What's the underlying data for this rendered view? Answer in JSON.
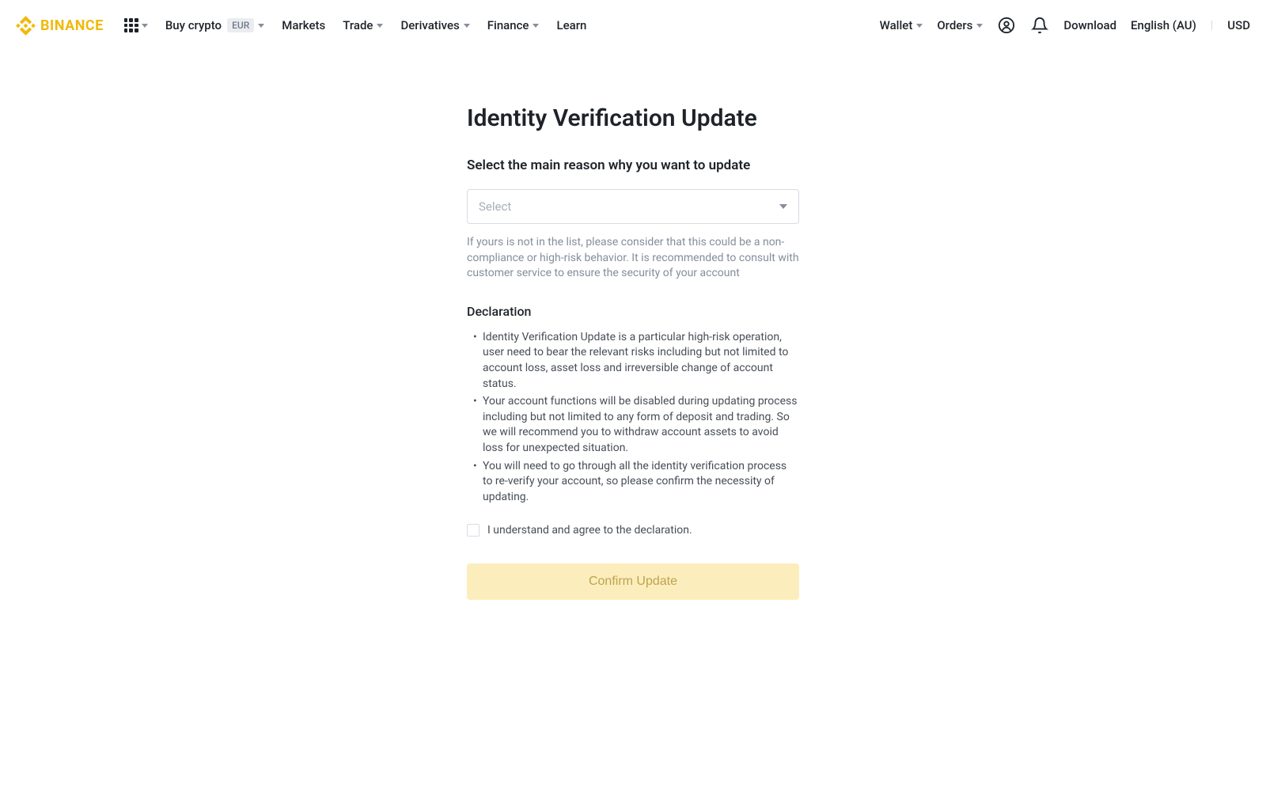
{
  "header": {
    "logo_text": "BINANCE",
    "buy_crypto_label": "Buy crypto",
    "currency_badge": "EUR",
    "nav": {
      "markets": "Markets",
      "trade": "Trade",
      "derivatives": "Derivatives",
      "finance": "Finance",
      "learn": "Learn"
    },
    "right": {
      "wallet": "Wallet",
      "orders": "Orders",
      "download": "Download",
      "language": "English (AU)",
      "currency": "USD"
    }
  },
  "main": {
    "title": "Identity Verification Update",
    "reason_label": "Select the main reason why you want to update",
    "select_placeholder": "Select",
    "helper_text": "If yours is not in the list, please consider that this could be a non-compliance or high-risk behavior. It is recommended to consult with customer service to ensure the security of your account",
    "declaration_title": "Declaration",
    "declarations": [
      "Identity Verification Update is a particular high-risk operation, user need to bear the relevant risks including but not limited to account loss, asset loss and irreversible change of account status.",
      "Your account functions will be disabled during updating process including but not limited to any form of deposit and trading. So we will recommend you to withdraw account assets to avoid loss for unexpected situation.",
      "You will need to go through all the identity verification process to re-verify your account, so please confirm the necessity of updating."
    ],
    "agree_label": "I understand and agree to the declaration.",
    "confirm_button": "Confirm Update"
  }
}
